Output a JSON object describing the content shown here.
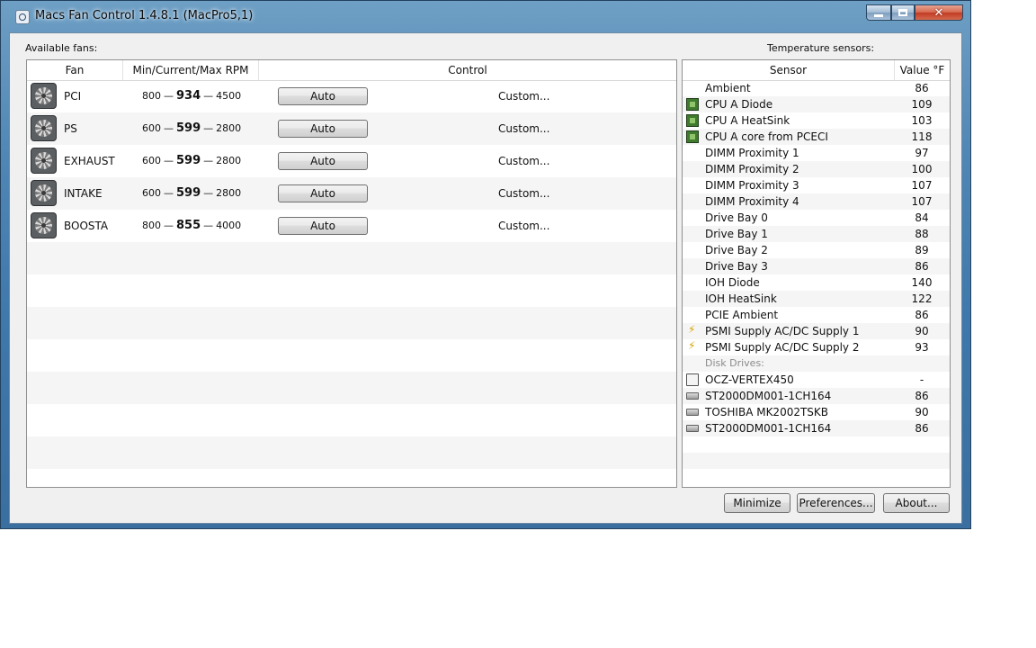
{
  "window": {
    "title": "Macs Fan Control 1.4.8.1 (MacPro5,1)"
  },
  "labels": {
    "available_fans": "Available fans:",
    "temperature_sensors": "Temperature sensors:"
  },
  "fans_table": {
    "headers": {
      "fan": "Fan",
      "rpm": "Min/Current/Max RPM",
      "control": "Control"
    },
    "rows": [
      {
        "name": "PCI",
        "min": "800",
        "current": "934",
        "max": "4500",
        "control": "Auto",
        "custom": "Custom..."
      },
      {
        "name": "PS",
        "min": "600",
        "current": "599",
        "max": "2800",
        "control": "Auto",
        "custom": "Custom..."
      },
      {
        "name": "EXHAUST",
        "min": "600",
        "current": "599",
        "max": "2800",
        "control": "Auto",
        "custom": "Custom..."
      },
      {
        "name": "INTAKE",
        "min": "600",
        "current": "599",
        "max": "2800",
        "control": "Auto",
        "custom": "Custom..."
      },
      {
        "name": "BOOSTA",
        "min": "800",
        "current": "855",
        "max": "4000",
        "control": "Auto",
        "custom": "Custom..."
      }
    ]
  },
  "sensors_table": {
    "headers": {
      "sensor": "Sensor",
      "value": "Value °F"
    },
    "rows": [
      {
        "icon": "none",
        "name": "Ambient",
        "value": "86"
      },
      {
        "icon": "cpu-chip-icon",
        "name": "CPU A Diode",
        "value": "109"
      },
      {
        "icon": "cpu-chip-icon",
        "name": "CPU A HeatSink",
        "value": "103"
      },
      {
        "icon": "cpu-chip-icon",
        "name": "CPU A core from PCECI",
        "value": "118"
      },
      {
        "icon": "none",
        "name": "DIMM Proximity 1",
        "value": "97"
      },
      {
        "icon": "none",
        "name": "DIMM Proximity 2",
        "value": "100"
      },
      {
        "icon": "none",
        "name": "DIMM Proximity 3",
        "value": "107"
      },
      {
        "icon": "none",
        "name": "DIMM Proximity 4",
        "value": "107"
      },
      {
        "icon": "none",
        "name": "Drive Bay 0",
        "value": "84"
      },
      {
        "icon": "none",
        "name": "Drive Bay 1",
        "value": "88"
      },
      {
        "icon": "none",
        "name": "Drive Bay 2",
        "value": "89"
      },
      {
        "icon": "none",
        "name": "Drive Bay 3",
        "value": "86"
      },
      {
        "icon": "none",
        "name": "IOH Diode",
        "value": "140"
      },
      {
        "icon": "none",
        "name": "IOH HeatSink",
        "value": "122"
      },
      {
        "icon": "none",
        "name": "PCIE Ambient",
        "value": "86"
      },
      {
        "icon": "power-bolt-icon",
        "name": "PSMI Supply AC/DC Supply 1",
        "value": "90"
      },
      {
        "icon": "power-bolt-icon",
        "name": "PSMI Supply AC/DC Supply 2",
        "value": "93"
      },
      {
        "icon": "group",
        "name": "Disk Drives:",
        "value": ""
      },
      {
        "icon": "ssd-icon",
        "name": "OCZ-VERTEX450",
        "value": "-"
      },
      {
        "icon": "hard-drive-icon",
        "name": "ST2000DM001-1CH164",
        "value": "86"
      },
      {
        "icon": "hard-drive-icon",
        "name": "TOSHIBA MK2002TSKB",
        "value": "90"
      },
      {
        "icon": "hard-drive-icon",
        "name": "ST2000DM001-1CH164",
        "value": "86"
      }
    ]
  },
  "buttons": {
    "minimize": "Minimize",
    "preferences": "Preferences...",
    "about": "About..."
  }
}
